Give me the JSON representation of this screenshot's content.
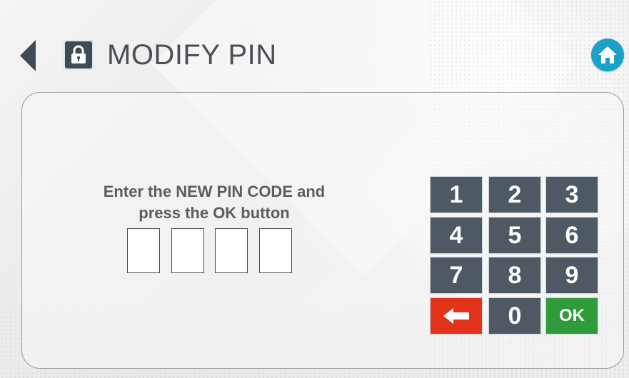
{
  "header": {
    "title": "MODIFY PIN",
    "back_icon": "arrow-left-icon",
    "lock_icon": "lock-icon",
    "home_icon": "home-icon"
  },
  "prompt": {
    "line1": "Enter the NEW PIN CODE and",
    "line2": "press the OK button"
  },
  "pin": {
    "digits": [
      "",
      "",
      "",
      ""
    ]
  },
  "keypad": {
    "keys": [
      "1",
      "2",
      "3",
      "4",
      "5",
      "6",
      "7",
      "8",
      "9",
      "",
      "0",
      "OK"
    ],
    "backspace_icon": "backspace-arrow-icon"
  },
  "colors": {
    "key": "#4e5963",
    "backspace": "#e1331a",
    "ok": "#2f9b3a",
    "home": "#1aa2c6"
  }
}
